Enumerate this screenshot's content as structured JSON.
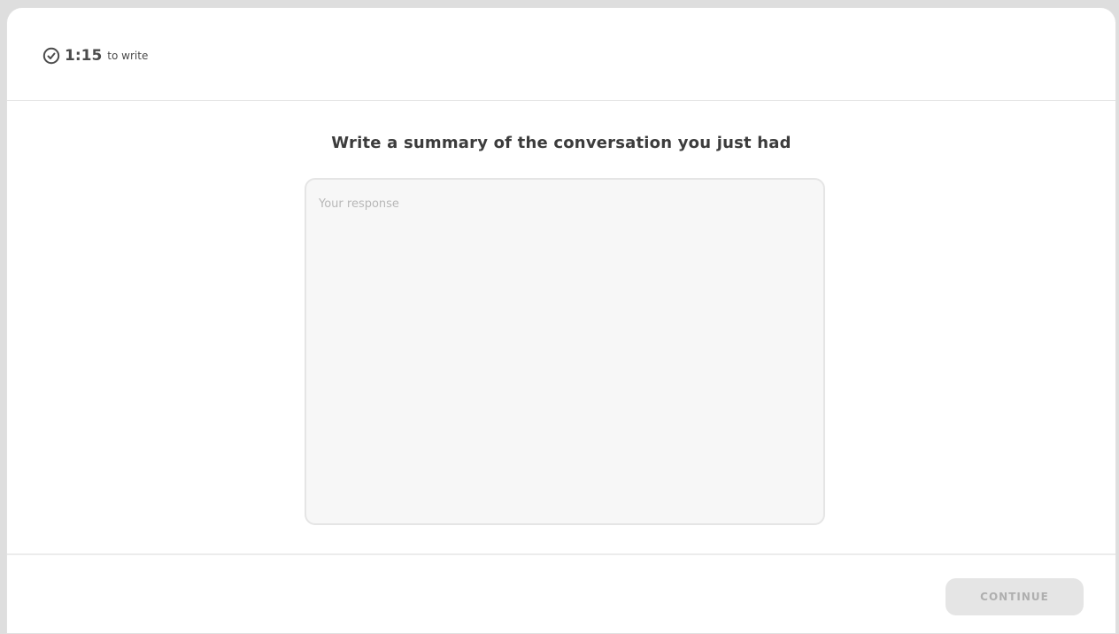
{
  "header": {
    "timer_icon": "stopwatch-icon",
    "timer_value": "1:15",
    "timer_suffix": "to write"
  },
  "prompt": {
    "title": "Write a summary of the conversation you just had"
  },
  "response": {
    "placeholder": "Your response",
    "value": ""
  },
  "footer": {
    "continue_label": "CONTINUE",
    "continue_disabled": true
  },
  "colors": {
    "text_primary": "#3c3c3c",
    "input_background": "#f7f7f7",
    "disabled_button": "#e5e5e5",
    "disabled_button_text": "#afafaf"
  }
}
